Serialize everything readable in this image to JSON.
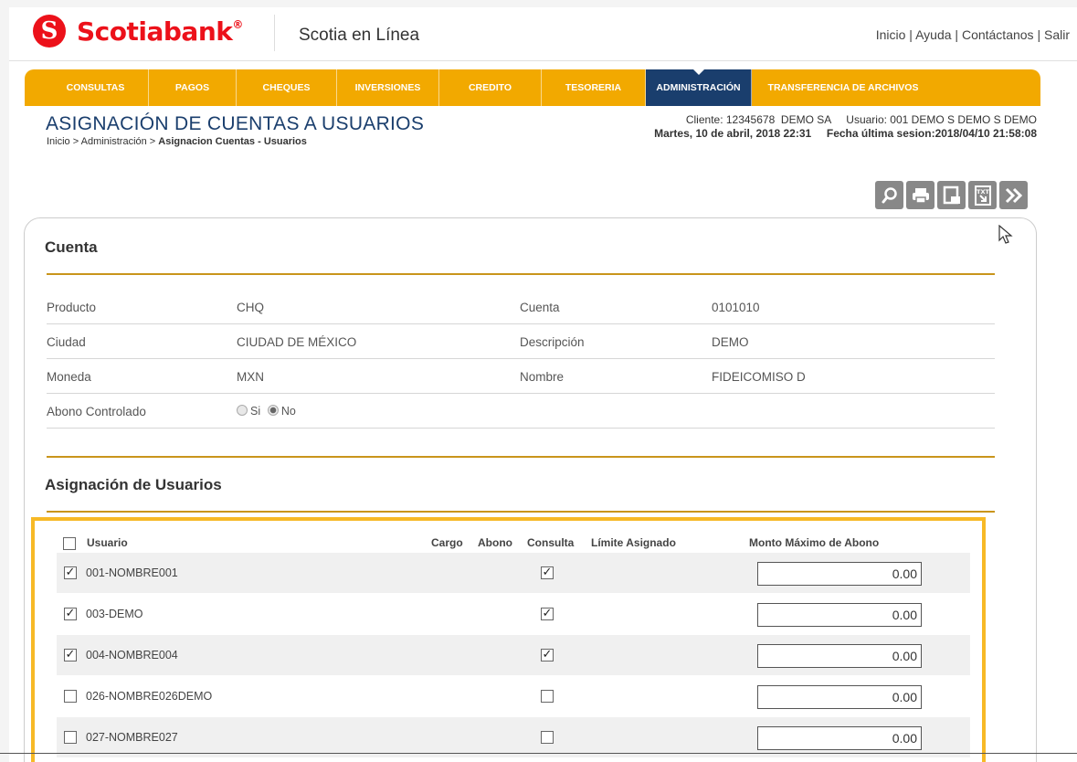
{
  "header": {
    "logo_mark": "S",
    "brand": "Scotiabank",
    "trademark": "®",
    "app_name": "Scotia en Línea",
    "links": [
      "Inicio",
      "Ayuda",
      "Contáctanos",
      "Salir"
    ],
    "link_separator": " | "
  },
  "nav": {
    "items": [
      {
        "label": "CONSULTAS"
      },
      {
        "label": "PAGOS"
      },
      {
        "label": "CHEQUES"
      },
      {
        "label": "INVERSIONES"
      },
      {
        "label": "CREDITO"
      },
      {
        "label": "TESORERIA"
      },
      {
        "label": "ADMINISTRACIÓN",
        "active": true
      },
      {
        "label": "TRANSFERENCIA DE ARCHIVOS"
      }
    ]
  },
  "page": {
    "title": "ASIGNACIÓN DE CUENTAS A USUARIOS",
    "breadcrumb_prefix": "Inicio > Administración > ",
    "breadcrumb_current": "Asignacion Cuentas - Usuarios"
  },
  "session": {
    "line1": "Cliente: 12345678  DEMO SA     Usuario: 001 DEMO S DEMO S DEMO",
    "line2": "Martes, 10 de abril, 2018 22:31     Fecha última sesion:2018/04/10 21:58:08"
  },
  "toolbar": {
    "icons": [
      "search-icon",
      "print-icon",
      "save-icon",
      "txt-export-icon",
      "next-icon"
    ],
    "txt_label": "TXT"
  },
  "cuenta": {
    "title": "Cuenta",
    "producto_label": "Producto",
    "producto_value": "CHQ",
    "cuenta_label": "Cuenta",
    "cuenta_value": "0101010",
    "ciudad_label": "Ciudad",
    "ciudad_value": "CIUDAD DE MÉXICO",
    "descripcion_label": "Descripción",
    "descripcion_value": "DEMO",
    "moneda_label": "Moneda",
    "moneda_value": "MXN",
    "nombre_label": "Nombre",
    "nombre_value": "FIDEICOMISO D",
    "abono_label": "Abono Controlado",
    "abono_si": "Si",
    "abono_no": "No",
    "abono_selected": "No"
  },
  "asignacion": {
    "title": "Asignación de Usuarios",
    "columns": {
      "usuario": "Usuario",
      "cargo": "Cargo",
      "abono": "Abono",
      "consulta": "Consulta",
      "limite": "Límite Asignado",
      "monto": "Monto Máximo de Abono"
    },
    "rows": [
      {
        "usuario": "001-NOMBRE001",
        "selected": true,
        "consulta": true,
        "monto": "0.00"
      },
      {
        "usuario": "003-DEMO",
        "selected": true,
        "consulta": true,
        "monto": "0.00"
      },
      {
        "usuario": "004-NOMBRE004",
        "selected": true,
        "consulta": true,
        "monto": "0.00"
      },
      {
        "usuario": "026-NOMBRE026DEMO",
        "selected": false,
        "consulta": false,
        "monto": "0.00"
      },
      {
        "usuario": "027-NOMBRE027",
        "selected": false,
        "consulta": false,
        "monto": "0.00"
      }
    ]
  },
  "colors": {
    "brand_red": "#ec111a",
    "nav_gold": "#f2a900",
    "nav_active": "#1a3e6d",
    "rule_gold": "#c9951b",
    "highlight": "#f7b926"
  }
}
